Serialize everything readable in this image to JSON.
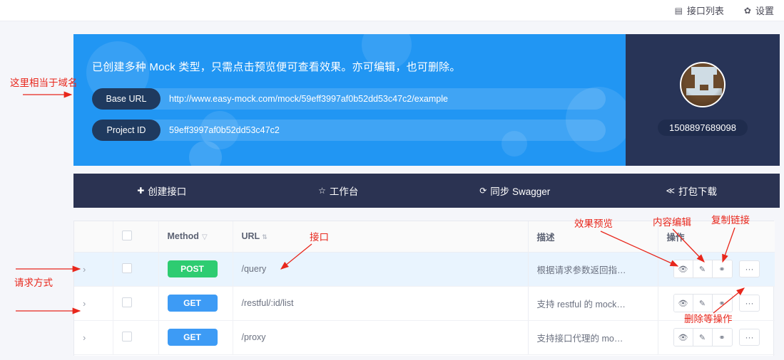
{
  "topnav": {
    "items": [
      {
        "label": "接口列表",
        "icon": "list-icon",
        "glyph": "▤"
      },
      {
        "label": "设置",
        "icon": "gear-icon",
        "glyph": "✿"
      }
    ]
  },
  "hero": {
    "description": "已创建多种 Mock 类型，只需点击预览便可查看效果。亦可编辑，也可删除。",
    "fields": [
      {
        "label": "Base URL",
        "value": "http://www.easy-mock.com/mock/59eff3997af0b52dd53c47c2/example"
      },
      {
        "label": "Project ID",
        "value": "59eff3997af0b52dd53c47c2"
      }
    ],
    "accent": "#2196f3"
  },
  "user": {
    "name": "1508897689098",
    "avatar_icon": "user-avatar"
  },
  "actions": [
    {
      "label": "创建接口",
      "glyph": "✚",
      "icon": "plus-icon"
    },
    {
      "label": "工作台",
      "glyph": "☆",
      "icon": "star-icon"
    },
    {
      "label": "同步 Swagger",
      "glyph": "⟳",
      "icon": "sync-icon"
    },
    {
      "label": "打包下载",
      "glyph": "≪",
      "icon": "download-icon"
    }
  ],
  "table": {
    "columns": [
      {
        "key": "expand",
        "label": ""
      },
      {
        "key": "check",
        "label": ""
      },
      {
        "key": "method",
        "label": "Method",
        "filter_icon": "filter-icon",
        "filter_glyph": "▽"
      },
      {
        "key": "url",
        "label": "URL",
        "sort_icon": "sort-icon",
        "sort_glyph": "⇅"
      },
      {
        "key": "desc",
        "label": "描述"
      },
      {
        "key": "op",
        "label": "操作"
      }
    ],
    "op_buttons": [
      {
        "name": "preview-icon",
        "glyph": "👁"
      },
      {
        "name": "edit-icon",
        "glyph": "✎"
      },
      {
        "name": "link-icon",
        "glyph": "⚭"
      }
    ],
    "more_glyph": "···",
    "expand_glyph": "›",
    "rows": [
      {
        "method": "POST",
        "method_class": "m-post",
        "url": "/query",
        "desc": "根据请求参数返回指…",
        "highlight": true
      },
      {
        "method": "GET",
        "method_class": "m-get",
        "url": "/restful/:id/list",
        "desc": "支持 restful 的 mock…",
        "highlight": false
      },
      {
        "method": "GET",
        "method_class": "m-get",
        "url": "/proxy",
        "desc": "支持接口代理的 mo…",
        "highlight": false
      }
    ]
  },
  "annotations": {
    "domain_note": "这里相当于域名",
    "interface_note": "接口",
    "request_method_note": "请求方式",
    "preview_note": "效果预览",
    "edit_note": "内容编辑",
    "copy_link_note": "复制链接",
    "delete_note": "删除等操作",
    "color": "#e8271c"
  }
}
